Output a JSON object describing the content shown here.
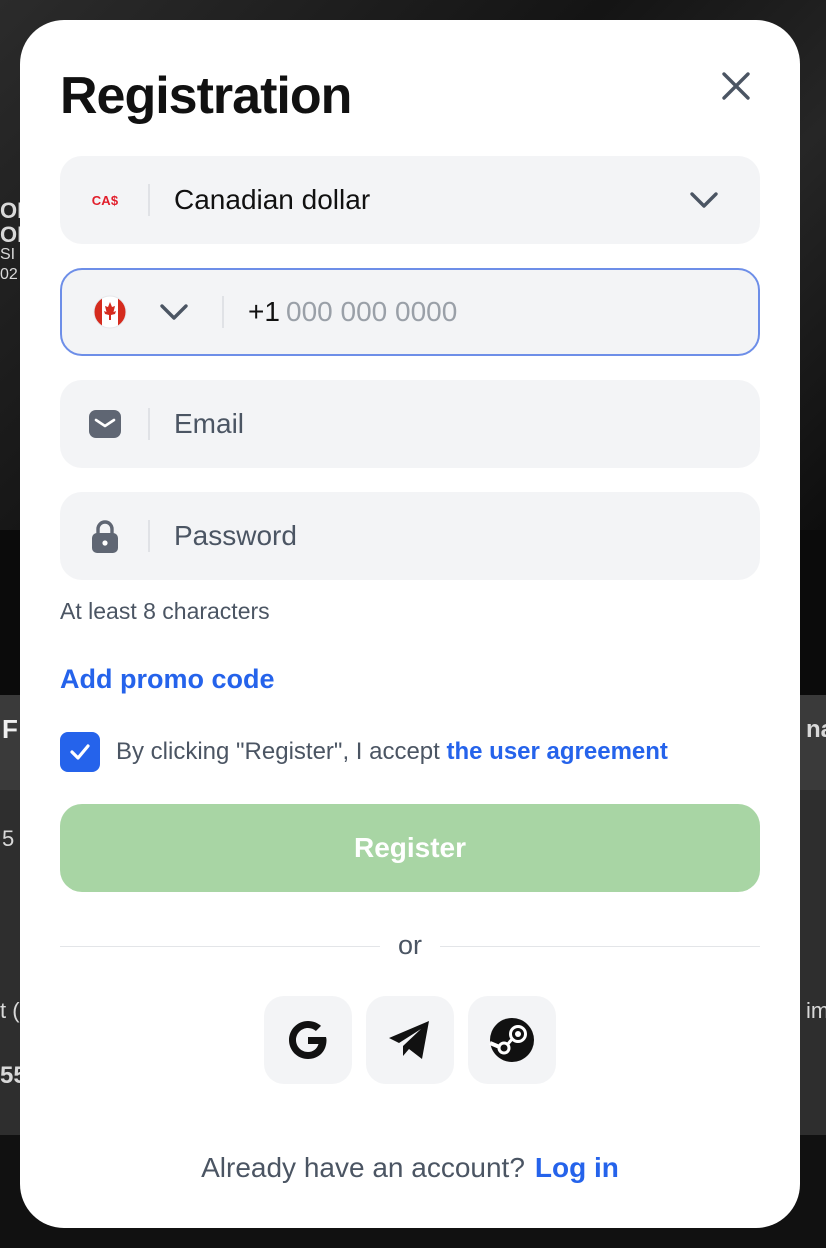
{
  "background": {
    "fragments": [
      "OI",
      "OP",
      "SI",
      "02",
      "F",
      "5",
      "t (",
      "55",
      "na",
      "im"
    ]
  },
  "modal": {
    "title": "Registration",
    "close_icon": "close-icon"
  },
  "currency": {
    "badge": "CA$",
    "label": "Canadian dollar"
  },
  "phone": {
    "country_icon": "canada-flag-icon",
    "code": "+1",
    "placeholder": "000 000 0000"
  },
  "email": {
    "placeholder": "Email"
  },
  "password": {
    "placeholder": "Password",
    "hint": "At least 8 characters"
  },
  "promo": {
    "label": "Add promo code"
  },
  "agreement": {
    "checked": true,
    "text": "By clicking \"Register\", I accept ",
    "link": "the user agreement"
  },
  "register": {
    "label": "Register"
  },
  "divider": {
    "label": "or"
  },
  "social": [
    {
      "name": "google-icon"
    },
    {
      "name": "telegram-icon"
    },
    {
      "name": "steam-icon"
    }
  ],
  "footer": {
    "question": "Already have an account?",
    "login": "Log in"
  },
  "colors": {
    "accent": "#2563eb",
    "register_disabled": "#a8d5a4",
    "field_bg": "#f3f4f6",
    "focus_border": "#6d8ee8",
    "currency_badge": "#e11d2a"
  }
}
